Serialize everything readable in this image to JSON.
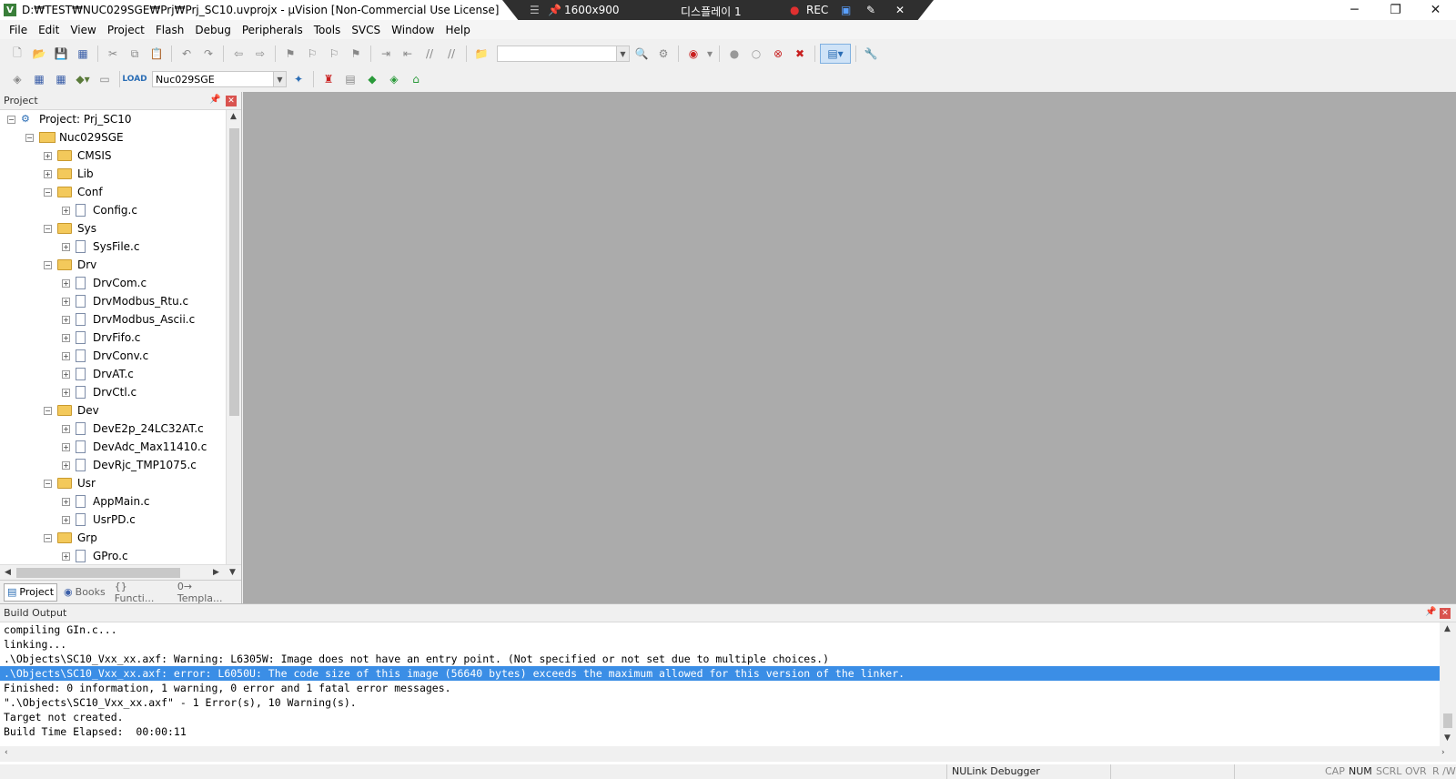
{
  "titlebar": {
    "title": "D:₩TEST₩NUC029SGE₩Prj₩Prj_SC10.uvprojx - µVision  [Non-Commercial Use License]",
    "app_icon": "uvision-icon",
    "minimize_icon": "minimize-icon",
    "maximize_icon": "restore-icon",
    "close_icon": "close-icon"
  },
  "recorder": {
    "resolution": "1600x900",
    "display": "디스플레이 1",
    "rec_label": "REC"
  },
  "menu": [
    "File",
    "Edit",
    "View",
    "Project",
    "Flash",
    "Debug",
    "Peripherals",
    "Tools",
    "SVCS",
    "Window",
    "Help"
  ],
  "toolbar2": {
    "target_select": "Nuc029SGE"
  },
  "project_panel": {
    "title": "Project",
    "tree": [
      {
        "label": "Project: Prj_SC10",
        "kind": "project",
        "level": 0,
        "exp": "−"
      },
      {
        "label": "Nuc029SGE",
        "kind": "target",
        "level": 1,
        "exp": "−"
      },
      {
        "label": "CMSIS",
        "kind": "folder",
        "level": 2,
        "exp": "+"
      },
      {
        "label": "Lib",
        "kind": "folder",
        "level": 2,
        "exp": "+"
      },
      {
        "label": "Conf",
        "kind": "folder",
        "level": 2,
        "exp": "−"
      },
      {
        "label": "Config.c",
        "kind": "file",
        "level": 3,
        "exp": "+"
      },
      {
        "label": "Sys",
        "kind": "folder",
        "level": 2,
        "exp": "−"
      },
      {
        "label": "SysFile.c",
        "kind": "file",
        "level": 3,
        "exp": "+"
      },
      {
        "label": "Drv",
        "kind": "folder",
        "level": 2,
        "exp": "−"
      },
      {
        "label": "DrvCom.c",
        "kind": "file",
        "level": 3,
        "exp": "+"
      },
      {
        "label": "DrvModbus_Rtu.c",
        "kind": "file",
        "level": 3,
        "exp": "+"
      },
      {
        "label": "DrvModbus_Ascii.c",
        "kind": "file",
        "level": 3,
        "exp": "+"
      },
      {
        "label": "DrvFifo.c",
        "kind": "file",
        "level": 3,
        "exp": "+"
      },
      {
        "label": "DrvConv.c",
        "kind": "file",
        "level": 3,
        "exp": "+"
      },
      {
        "label": "DrvAT.c",
        "kind": "file",
        "level": 3,
        "exp": "+"
      },
      {
        "label": "DrvCtl.c",
        "kind": "file",
        "level": 3,
        "exp": "+"
      },
      {
        "label": "Dev",
        "kind": "folder",
        "level": 2,
        "exp": "−"
      },
      {
        "label": "DevE2p_24LC32AT.c",
        "kind": "file",
        "level": 3,
        "exp": "+"
      },
      {
        "label": "DevAdc_Max11410.c",
        "kind": "file",
        "level": 3,
        "exp": "+"
      },
      {
        "label": "DevRjc_TMP1075.c",
        "kind": "file",
        "level": 3,
        "exp": "+"
      },
      {
        "label": "Usr",
        "kind": "folder",
        "level": 2,
        "exp": "−"
      },
      {
        "label": "AppMain.c",
        "kind": "file",
        "level": 3,
        "exp": "+"
      },
      {
        "label": "UsrPD.c",
        "kind": "file",
        "level": 3,
        "exp": "+"
      },
      {
        "label": "Grp",
        "kind": "folder",
        "level": 2,
        "exp": "−"
      },
      {
        "label": "GPro.c",
        "kind": "file",
        "level": 3,
        "exp": "+"
      }
    ],
    "tabs": [
      "Project",
      "Books",
      "{} Functi...",
      "0→ Templa..."
    ]
  },
  "build_output": {
    "title": "Build Output",
    "lines": [
      "compiling GIn.c...",
      "linking...",
      ".\\Objects\\SC10_Vxx_xx.axf: Warning: L6305W: Image does not have an entry point. (Not specified or not set due to multiple choices.)",
      ".\\Objects\\SC10_Vxx_xx.axf: error: L6050U: The code size of this image (56640 bytes) exceeds the maximum allowed for this version of the linker.",
      "Finished: 0 information, 1 warning, 0 error and 1 fatal error messages.",
      "\".\\Objects\\SC10_Vxx_xx.axf\" - 1 Error(s), 10 Warning(s).",
      "Target not created.",
      "Build Time Elapsed:  00:00:11"
    ],
    "selected_index": 3
  },
  "statusbar": {
    "debugger": "NULink Debugger",
    "cap": "CAP",
    "num": "NUM",
    "scrl": "SCRL",
    "ovr": "OVR",
    "rw": "R /W"
  },
  "colors": {
    "editor_bg": "#ababab",
    "selection": "#3b8ee6",
    "close_red": "#d9534f"
  }
}
